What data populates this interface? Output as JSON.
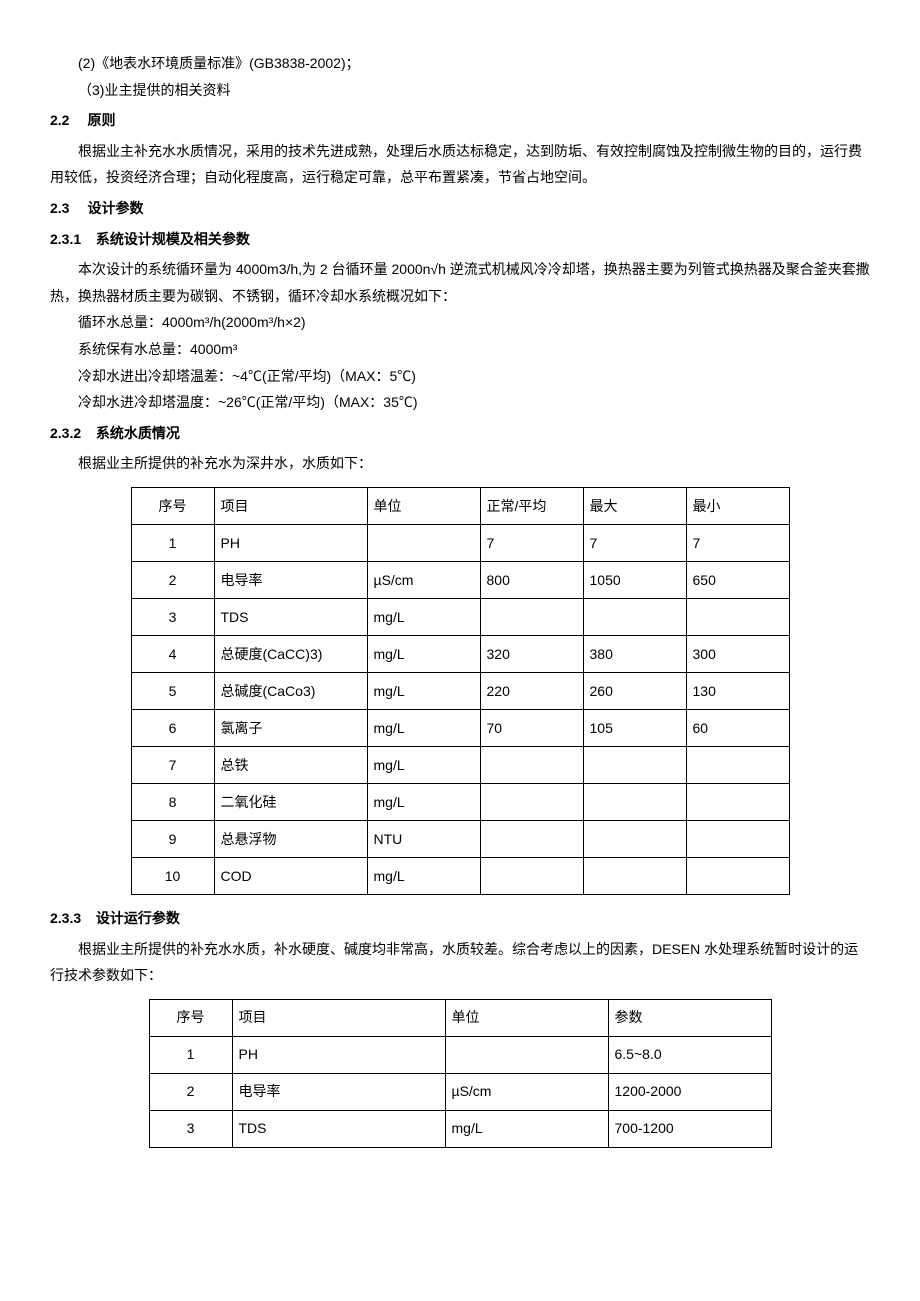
{
  "intro": {
    "line1": "(2)《地表水环境质量标准》(GB3838-2002)；",
    "line2": "（3)业主提供的相关资料"
  },
  "s22": {
    "num": "2.2",
    "title": "原则",
    "p1": "根据业主补充水水质情况，采用的技术先进成熟，处理后水质达标稳定，达到防垢、有效控制腐蚀及控制微生物的目的，运行费用较低，投资经济合理；自动化程度高，运行稳定可靠，总平布置紧凑，节省占地空间。"
  },
  "s23": {
    "num": "2.3",
    "title": "设计参数"
  },
  "s231": {
    "num": "2.3.1",
    "title": "系统设计规模及相关参数",
    "p1": "本次设计的系统循环量为 4000m3/h,为 2 台循环量 2000n√h 逆流式机械风冷冷却塔，换热器主要为列管式换热器及聚合釜夹套撒热，换热器材质主要为碳钢、不锈钢，循环冷却水系统概况如下：",
    "p2": "循环水总量：4000m³/h(2000m³/h×2)",
    "p3": "系统保有水总量：4000m³",
    "p4": "冷却水进出冷却塔温差：~4℃(正常/平均)（MAX：5℃)",
    "p5": "冷却水进冷却塔温度：~26℃(正常/平均)（MAX：35℃)"
  },
  "s232": {
    "num": "2.3.2",
    "title": "系统水质情况",
    "p1": "根据业主所提供的补充水为深井水，水质如下：",
    "table": {
      "headers": [
        "序号",
        "项目",
        "单位",
        "正常/平均",
        "最大",
        "最小"
      ],
      "rows": [
        {
          "n": "1",
          "item": "PH",
          "unit": "",
          "avg": "7",
          "max": "7",
          "min": "7"
        },
        {
          "n": "2",
          "item": "电导率",
          "unit": "µS/cm",
          "avg": "800",
          "max": "1050",
          "min": "650"
        },
        {
          "n": "3",
          "item": "TDS",
          "unit": "mg/L",
          "avg": "",
          "max": "",
          "min": ""
        },
        {
          "n": "4",
          "item": "总硬度(CaCC)3)",
          "unit": "mg/L",
          "avg": "320",
          "max": "380",
          "min": "300"
        },
        {
          "n": "5",
          "item": "总碱度(CaCo3)",
          "unit": "mg/L",
          "avg": "220",
          "max": "260",
          "min": "130"
        },
        {
          "n": "6",
          "item": "氯离子",
          "unit": "mg/L",
          "avg": "70",
          "max": "105",
          "min": "60"
        },
        {
          "n": "7",
          "item": "总铁",
          "unit": "mg/L",
          "avg": "",
          "max": "",
          "min": ""
        },
        {
          "n": "8",
          "item": "二氧化硅",
          "unit": "mg/L",
          "avg": "",
          "max": "",
          "min": ""
        },
        {
          "n": "9",
          "item": "总悬浮物",
          "unit": "NTU",
          "avg": "",
          "max": "",
          "min": ""
        },
        {
          "n": "10",
          "item": "COD",
          "unit": "mg/L",
          "avg": "",
          "max": "",
          "min": ""
        }
      ]
    }
  },
  "s233": {
    "num": "2.3.3",
    "title": "设计运行参数",
    "p1": "根据业主所提供的补充水水质，补水硬度、碱度均非常高，水质较差。综合考虑以上的因素，DESEN 水处理系统暂时设计的运行技术参数如下：",
    "table": {
      "headers": [
        "序号",
        "项目",
        "单位",
        "参数"
      ],
      "rows": [
        {
          "n": "1",
          "item": "PH",
          "unit": "",
          "param": "6.5~8.0"
        },
        {
          "n": "2",
          "item": "电导率",
          "unit": "µS/cm",
          "param": "1200-2000"
        },
        {
          "n": "3",
          "item": "TDS",
          "unit": "mg/L",
          "param": "700-1200"
        }
      ]
    }
  }
}
